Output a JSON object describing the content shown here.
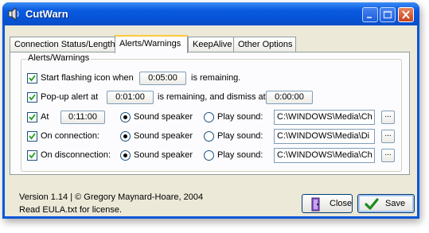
{
  "window": {
    "title": "CutWarn"
  },
  "tabs": [
    {
      "label": "Connection Status/Length",
      "active": false
    },
    {
      "label": "Alerts/Warnings",
      "active": true
    },
    {
      "label": "KeepAlive",
      "active": false
    },
    {
      "label": "Other Options",
      "active": false
    }
  ],
  "group": {
    "label": "Alerts/Warnings"
  },
  "rows": {
    "flash": {
      "checked": true,
      "label_pre": "Start flashing icon when",
      "time": "0:05:00",
      "label_post": "is remaining."
    },
    "popup": {
      "checked": true,
      "label_pre": "Pop-up alert at",
      "time": "0:01:00",
      "label_mid": "is remaining, and dismiss at",
      "dismiss_time": "0:00:00"
    },
    "at": {
      "checked": true,
      "label": "At",
      "time": "0:11:00",
      "option_speaker": "Sound speaker",
      "option_play": "Play sound:",
      "selected": "speaker",
      "path": "C:\\WINDOWS\\Media\\Ch"
    },
    "connection": {
      "checked": true,
      "label": "On connection:",
      "option_speaker": "Sound speaker",
      "option_play": "Play sound:",
      "selected": "speaker",
      "path": "C:\\WINDOWS\\Media\\Di"
    },
    "disconnection": {
      "checked": true,
      "label": "On disconnection:",
      "option_speaker": "Sound speaker",
      "option_play": "Play sound:",
      "selected": "speaker",
      "path": "C:\\WINDOWS\\Media\\Ch"
    }
  },
  "browse_label": "...",
  "footer": {
    "version": "Version 1.14 | © Gregory Maynard-Hoare, 2004",
    "license": "Read EULA.txt for license."
  },
  "buttons": {
    "close": "Close",
    "save": "Save"
  },
  "icons": {
    "app": "speaker-icon",
    "close": "door-exit-icon",
    "save": "green-check-icon"
  },
  "colors": {
    "titlebar": "#0a5ae0",
    "face": "#ece9d8",
    "tab_highlight": "#ffc83c"
  }
}
